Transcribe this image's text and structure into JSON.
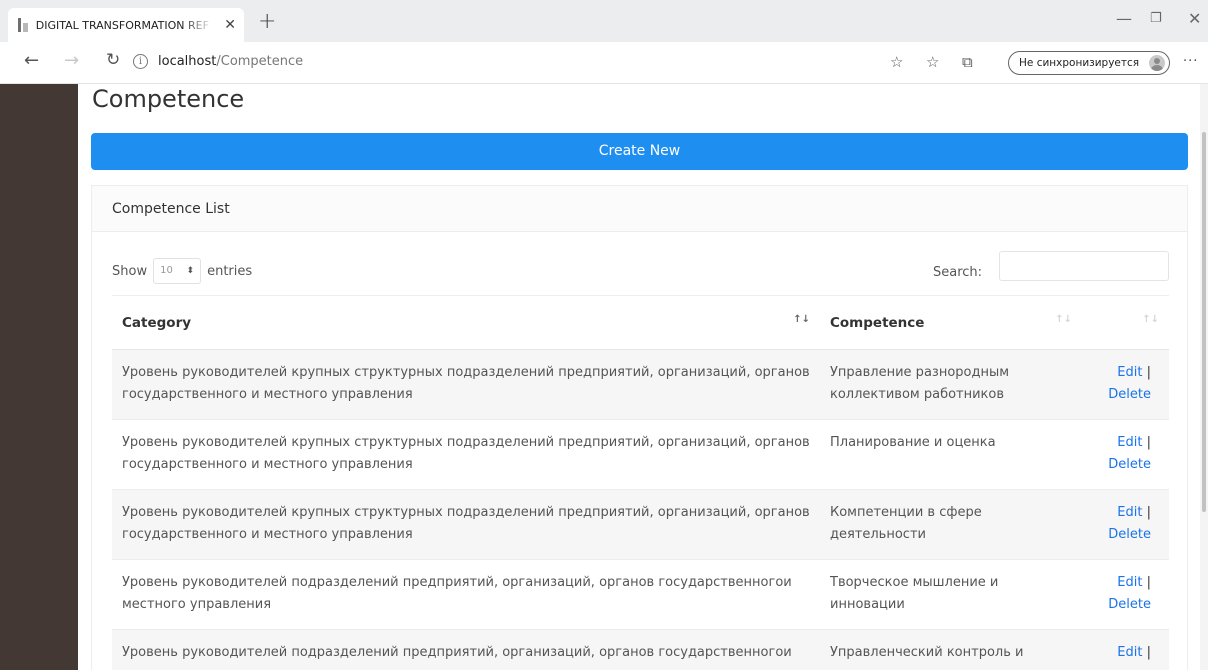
{
  "browser": {
    "tab_title": "DIGITAL TRANSFORMATION REF",
    "tab_close": "✕",
    "new_tab": "+",
    "url_host": "localhost",
    "url_path": "/Competence",
    "sync_label": "Не синхронизируется",
    "more": "···"
  },
  "page": {
    "title": "Competence",
    "create_button": "Create New"
  },
  "card": {
    "header": "Competence List",
    "show_label": "Show",
    "entries_value": "10",
    "entries_label": "entries",
    "search_label": "Search:"
  },
  "table": {
    "columns": [
      "Category",
      "Competence",
      ""
    ],
    "rows": [
      {
        "category": "Уровень руководителей крупных структурных подразделений предприятий, организаций, органов государственного и местного управления",
        "competence": "Управление разнородным коллективом работников",
        "edit": "Edit",
        "sep": " |",
        "delete": "Delete"
      },
      {
        "category": "Уровень руководителей крупных структурных подразделений предприятий, организаций, органов государственного и местного управления",
        "competence": "Планирование и оценка",
        "edit": "Edit",
        "sep": " |",
        "delete": "Delete"
      },
      {
        "category": "Уровень руководителей крупных структурных подразделений предприятий, организаций, органов государственного и местного управления",
        "competence": "Компетенции в сфере деятельности",
        "edit": "Edit",
        "sep": " |",
        "delete": "Delete"
      },
      {
        "category": "Уровень руководителей подразделений предприятий, организаций, органов государственногои местного управления",
        "competence": "Творческое мышление и инновации",
        "edit": "Edit",
        "sep": " |",
        "delete": "Delete"
      },
      {
        "category": "Уровень руководителей подразделений предприятий, организаций, органов государственногои",
        "competence": "Управленческий контроль и",
        "edit": "Edit",
        "sep": " |",
        "delete": ""
      }
    ]
  }
}
